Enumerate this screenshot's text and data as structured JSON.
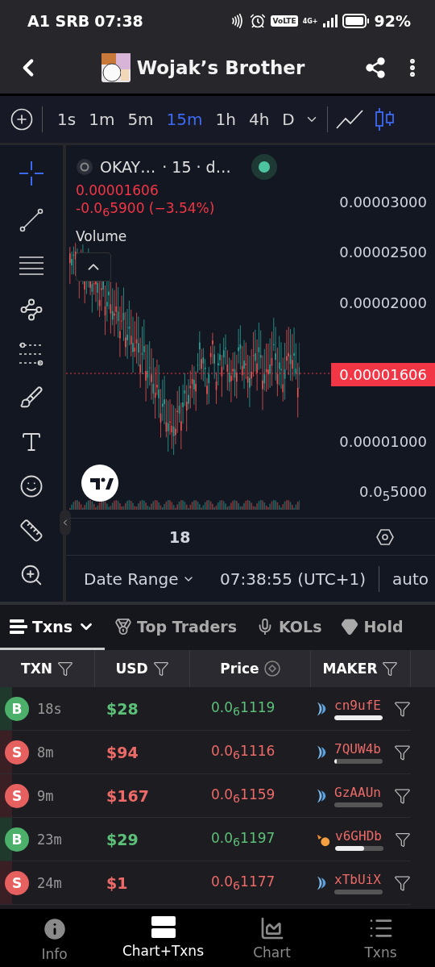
{
  "status_bar": {
    "carrier": "A1 SRB",
    "time": "07:38",
    "volte": "VoLTE",
    "network": "4G+",
    "battery": "92%"
  },
  "header": {
    "title": "Wojak’s Brother"
  },
  "timeframes": [
    {
      "label": "1s",
      "selected": false
    },
    {
      "label": "1m",
      "selected": false
    },
    {
      "label": "5m",
      "selected": false
    },
    {
      "label": "15m",
      "selected": true
    },
    {
      "label": "1h",
      "selected": false
    },
    {
      "label": "4h",
      "selected": false
    },
    {
      "label": "D",
      "selected": false
    }
  ],
  "chart_types": [
    {
      "kind": "line",
      "selected": false
    },
    {
      "kind": "candles",
      "selected": true
    }
  ],
  "tools": [
    {
      "kind": "crosshair",
      "selected": true
    },
    {
      "kind": "trend",
      "selected": false
    },
    {
      "kind": "hlines",
      "selected": false
    },
    {
      "kind": "pattern",
      "selected": false
    },
    {
      "kind": "channel",
      "selected": false
    },
    {
      "kind": "brush",
      "selected": false
    },
    {
      "kind": "text",
      "selected": false
    },
    {
      "kind": "emoji",
      "selected": false
    },
    {
      "kind": "ruler",
      "selected": false
    },
    {
      "kind": "zoom",
      "selected": false
    }
  ],
  "chart": {
    "symbol": "OKAY…",
    "interval": "· 15 · d…",
    "price": "0.00001606",
    "change": "-0.0$_{6}$5900 (−3.54%)",
    "volume_label": "Volume",
    "price_axis": [
      "0.00003000",
      "0.00002500",
      "0.00002000",
      "0.00001000",
      "0.0$_{5}$5000"
    ],
    "current_price": "0.00001606",
    "x_label": "18",
    "date_range": "Date Range",
    "clock": "07:38:55 (UTC+1)",
    "scale": "auto"
  },
  "tabs": [
    {
      "label": "Txns",
      "kind": "menu",
      "selected": true
    },
    {
      "label": "Top Traders",
      "kind": "medal",
      "selected": false
    },
    {
      "label": "KOLs",
      "kind": "mic",
      "selected": false
    },
    {
      "label": "Hold",
      "kind": "gem",
      "selected": false
    }
  ],
  "table": {
    "columns": [
      "TXN",
      "USD",
      "Price",
      "MAKER"
    ],
    "rows": [
      {
        "side": "B",
        "kind": "buy",
        "time": "18s",
        "usd": "$28",
        "price": "0.0$_{6}$1119",
        "maker": {
          "address": "cn9ufE",
          "kind": "fish",
          "level": 1
        }
      },
      {
        "side": "S",
        "kind": "sell",
        "time": "8m",
        "usd": "$94",
        "price": "0.0$_{6}$1116",
        "maker": {
          "address": "7QUW4b",
          "kind": "fish",
          "level": 0.05
        }
      },
      {
        "side": "S",
        "kind": "sell",
        "time": "9m",
        "usd": "$167",
        "price": "0.0$_{6}$1159",
        "maker": {
          "address": "GzAAUn",
          "kind": "fish",
          "level": 0
        }
      },
      {
        "side": "B",
        "kind": "buy",
        "time": "23m",
        "usd": "$29",
        "price": "0.0$_{6}$1197",
        "maker": {
          "address": "v6GHDb",
          "kind": "shrimp",
          "level": 0.6
        }
      },
      {
        "side": "S",
        "kind": "sell",
        "time": "24m",
        "usd": "$1",
        "price": "0.0$_{6}$1177",
        "maker": {
          "address": "xTbUiX",
          "kind": "fish",
          "level": 0
        }
      }
    ]
  },
  "bottom_nav": [
    {
      "label": "Info",
      "kind": "info",
      "selected": false
    },
    {
      "label": "Chart+Txns",
      "kind": "split",
      "selected": true
    },
    {
      "label": "Chart",
      "kind": "chart",
      "selected": false
    },
    {
      "label": "Txns",
      "kind": "list",
      "selected": false
    }
  ]
}
